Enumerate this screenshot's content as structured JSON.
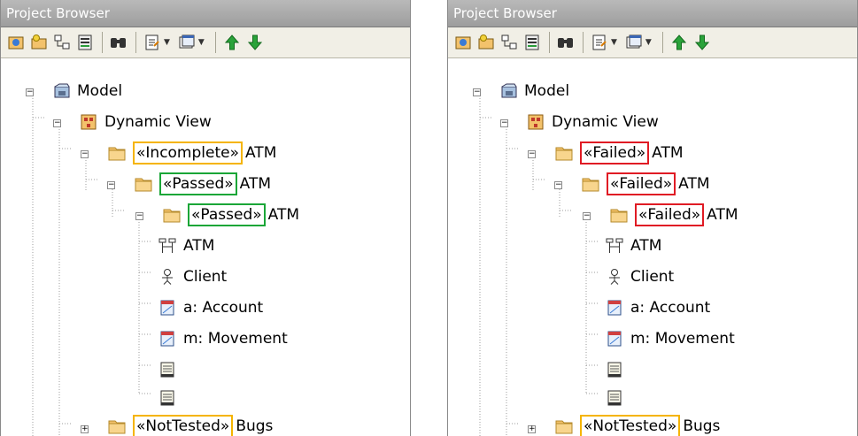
{
  "colors": {
    "incomplete": "#f5b400",
    "passed": "#1aa637",
    "failed": "#e01b24",
    "nottested": "#f5b400",
    "folder": "#f3c26b",
    "titlebar": "#a8a8a8"
  },
  "panels": [
    {
      "title": "Project Browser",
      "toolbar": [
        "new-package-icon",
        "new-diagram-icon",
        "new-element-icon",
        "properties-icon",
        "find-icon",
        "document-icon",
        "document-dropdown-icon",
        "window-icon",
        "window-dropdown-icon",
        "move-up-icon",
        "move-down-icon"
      ],
      "tree": {
        "model": "Model",
        "dynamic_view": "Dynamic View",
        "pkg1": {
          "stereo": "«Incomplete»",
          "name": "ATM",
          "status": "incomplete"
        },
        "pkg2": {
          "stereo": "«Passed»",
          "name": "ATM",
          "status": "passed"
        },
        "pkg3": {
          "stereo": "«Passed»",
          "name": "ATM",
          "status": "passed"
        },
        "items": [
          "ATM",
          "Client",
          "a: Account",
          "m: Movement"
        ],
        "bugs": {
          "stereo": "«NotTested»",
          "name": "Bugs",
          "status": "nottested"
        }
      }
    },
    {
      "title": "Project Browser",
      "toolbar": [
        "new-package-icon",
        "new-diagram-icon",
        "new-element-icon",
        "properties-icon",
        "find-icon",
        "document-icon",
        "document-dropdown-icon",
        "window-icon",
        "window-dropdown-icon",
        "move-up-icon",
        "move-down-icon"
      ],
      "tree": {
        "model": "Model",
        "dynamic_view": "Dynamic View",
        "pkg1": {
          "stereo": "«Failed»",
          "name": "ATM",
          "status": "failed"
        },
        "pkg2": {
          "stereo": "«Failed»",
          "name": "ATM",
          "status": "failed"
        },
        "pkg3": {
          "stereo": "«Failed»",
          "name": "ATM",
          "status": "failed"
        },
        "items": [
          "ATM",
          "Client",
          "a: Account",
          "m: Movement"
        ],
        "bugs": {
          "stereo": "«NotTested»",
          "name": "Bugs",
          "status": "nottested"
        }
      }
    }
  ]
}
